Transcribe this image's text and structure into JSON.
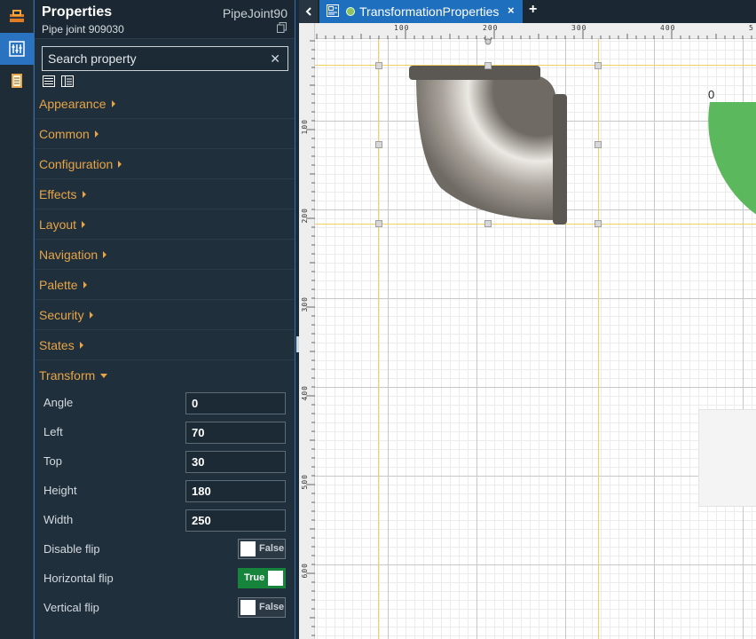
{
  "rail": {
    "items": [
      {
        "name": "toolbox",
        "icon": "toolbox-icon"
      },
      {
        "name": "properties",
        "icon": "properties-icon",
        "active": true
      },
      {
        "name": "project",
        "icon": "book-icon"
      }
    ]
  },
  "panel": {
    "title": "Properties",
    "subtitle": "Pipe joint 909030",
    "component_name": "PipeJoint90",
    "search": {
      "placeholder": "Search property",
      "value": ""
    },
    "categories": [
      {
        "label": "Appearance"
      },
      {
        "label": "Common"
      },
      {
        "label": "Configuration"
      },
      {
        "label": "Effects"
      },
      {
        "label": "Layout"
      },
      {
        "label": "Navigation"
      },
      {
        "label": "Palette"
      },
      {
        "label": "Security"
      },
      {
        "label": "States"
      },
      {
        "label": "Transform",
        "expanded": true
      }
    ],
    "transform": {
      "angle": {
        "label": "Angle",
        "value": "0"
      },
      "left": {
        "label": "Left",
        "value": "70"
      },
      "top": {
        "label": "Top",
        "value": "30"
      },
      "height": {
        "label": "Height",
        "value": "180"
      },
      "width": {
        "label": "Width",
        "value": "250"
      },
      "disable_flip": {
        "label": "Disable flip",
        "state": "False"
      },
      "horizontal_flip": {
        "label": "Horizontal flip",
        "state": "True"
      },
      "vertical_flip": {
        "label": "Vertical flip",
        "state": "False"
      }
    }
  },
  "tabs": {
    "active_label": "TransformationProperties",
    "close": "×",
    "add": "+"
  },
  "canvas": {
    "ruler_top_labels": [
      "100",
      "200",
      "300",
      "400",
      "5"
    ],
    "ruler_left_labels": [
      "100",
      "200",
      "300",
      "400",
      "500",
      "600"
    ],
    "gauge_value": "0"
  },
  "colors": {
    "accent": "#1f6fbf",
    "category": "#e8a547",
    "toggle_on": "#17843c",
    "gauge": "#5cb85c"
  }
}
